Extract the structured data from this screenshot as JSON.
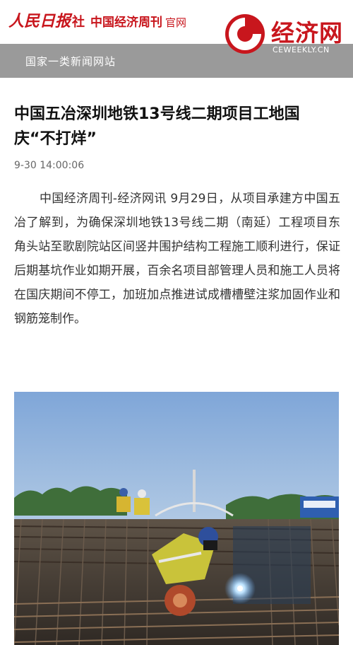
{
  "header": {
    "brand_rmrb": "人民日报",
    "brand_she": "社",
    "brand_zhoukan": "中国经济周刊",
    "brand_guanwang": "官网",
    "logo_text": "经济网",
    "logo_sub": "CEWEEKLY.CN",
    "brand_color": "#c8161d"
  },
  "bar": {
    "label": "国家一类新闻网站",
    "bg_color": "#9a9a9a"
  },
  "article": {
    "title": "中国五冶深圳地铁13号线二期项目工地国庆“不打烊”",
    "date": "9-30 14:00:06",
    "body": "中国经济周刊-经济网讯 9月29日，从项目承建方中国五冶了解到，为确保深圳地铁13号线二期（南延）工程项目东角头站至歌剧院站区间竖井围护结构工程施工顺利进行，保证后期基坑作业如期开展，百余名项目部管理人员和施工人员将在国庆期间不停工，加班加点推进试成槽槽壁注浆加固作业和钢筋笼制作。"
  },
  "icons": {
    "logo_mark": "ceweekly-logo-icon"
  }
}
